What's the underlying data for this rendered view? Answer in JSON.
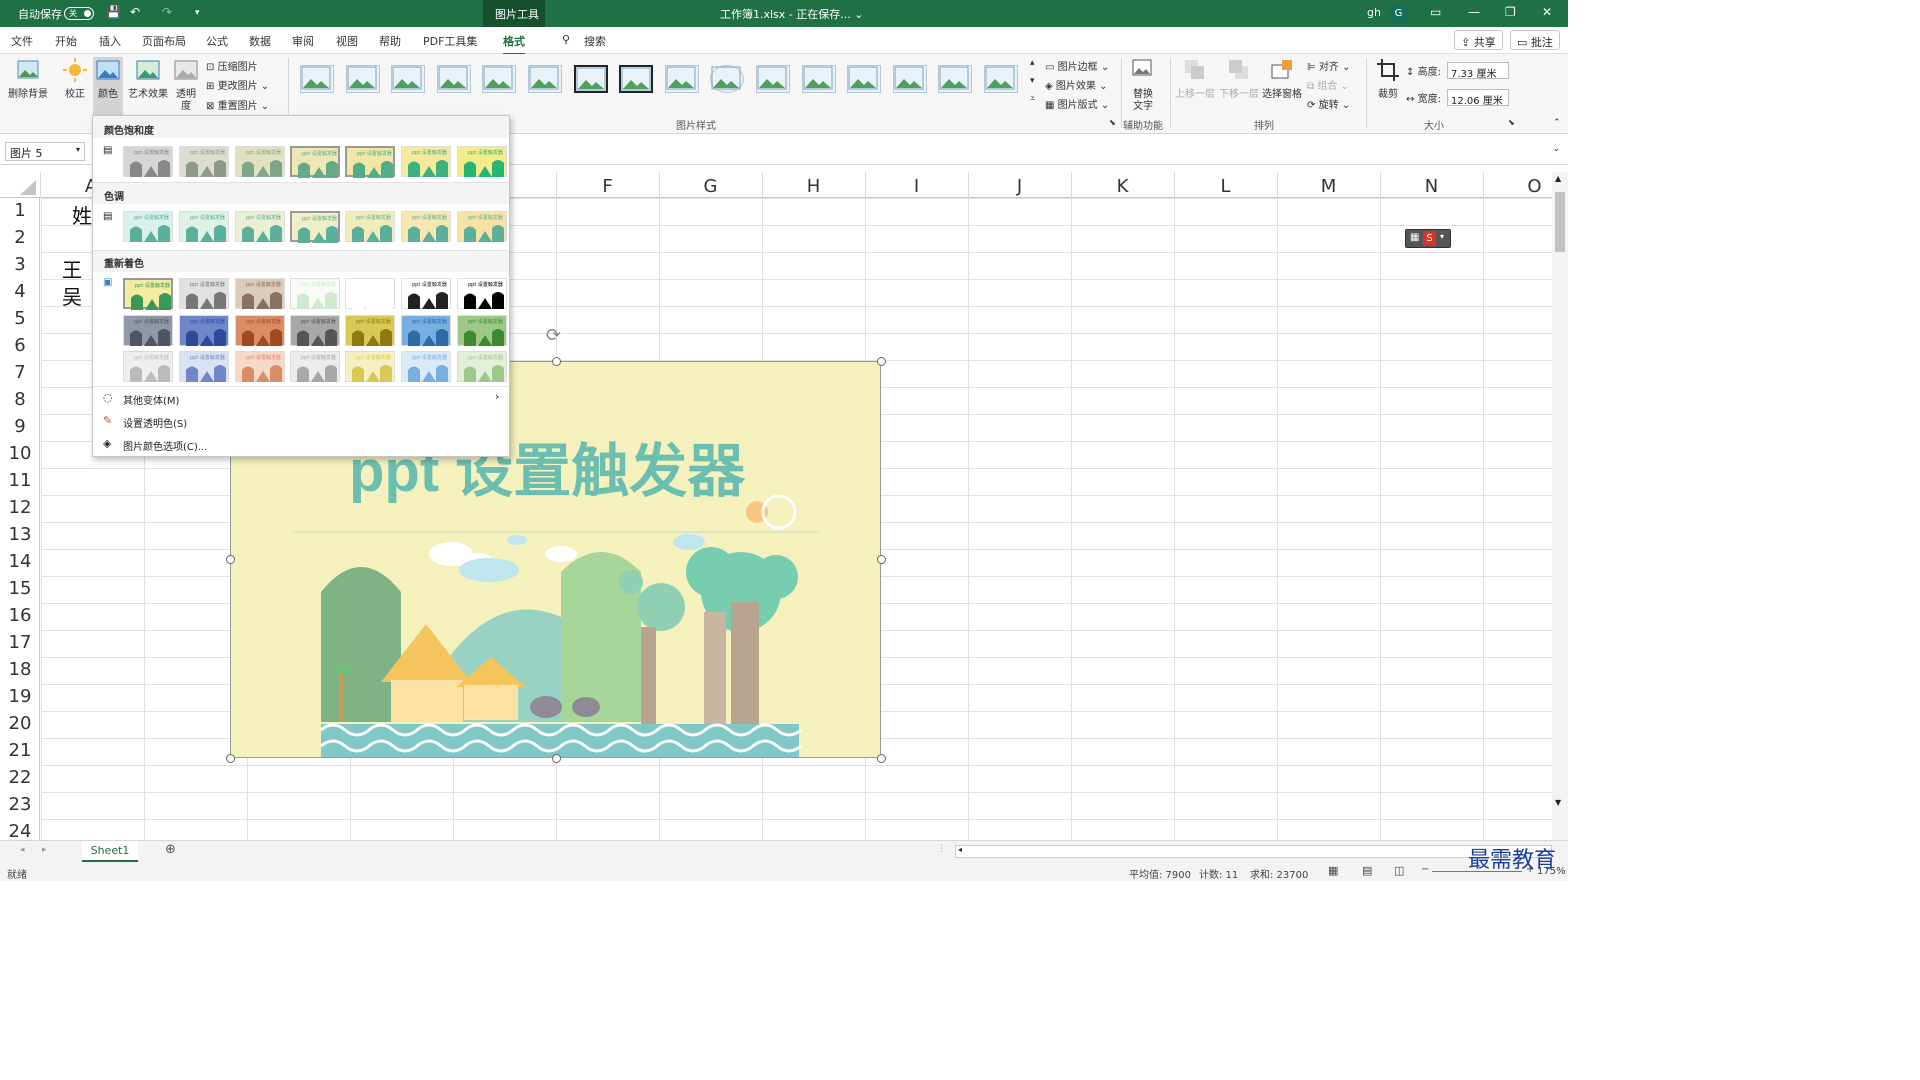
{
  "titlebar": {
    "autosave": "自动保存",
    "autosave_state": "关",
    "tool_tab": "图片工具",
    "filename": "工作簿1.xlsx - 正在保存... ⌄",
    "user": "gh",
    "avatar": "G"
  },
  "tabs": [
    "文件",
    "开始",
    "插入",
    "页面布局",
    "公式",
    "数据",
    "审阅",
    "视图",
    "帮助",
    "PDF工具集",
    "格式"
  ],
  "search": "搜索",
  "share": "共享",
  "comment": "批注",
  "ribbon": {
    "remove_bg": "删除背景",
    "correct": "校正",
    "color": "颜色",
    "art": "艺术效果",
    "transparency_1": "透明",
    "transparency_2": "度",
    "compress": "压缩图片",
    "change": "更改图片",
    "reset": "重置图片",
    "border": "图片边框",
    "effect": "图片效果",
    "layout": "图片版式",
    "styles_group": "图片样式",
    "alt_1": "替换",
    "alt_2": "文字",
    "accessibility": "辅助功能",
    "bring_fwd": "上移一层",
    "send_back": "下移一层",
    "selection_pane": "选择窗格",
    "align": "对齐",
    "group": "组合",
    "rotate": "旋转",
    "arrange": "排列",
    "crop": "裁剪",
    "height_label": "高度:",
    "height_value": "7.33 厘米",
    "width_label": "宽度:",
    "width_value": "12.06 厘米",
    "size": "大小"
  },
  "namebox": "图片 5",
  "columns": [
    "A",
    "F",
    "G",
    "H",
    "I",
    "J",
    "K",
    "L",
    "M",
    "N",
    "O"
  ],
  "rows": [
    "1",
    "2",
    "3",
    "4",
    "5",
    "6",
    "7",
    "8",
    "9",
    "10",
    "11",
    "12",
    "13",
    "14",
    "15",
    "16",
    "17",
    "18",
    "19",
    "20",
    "21",
    "22",
    "23",
    "24"
  ],
  "cells": {
    "a1": "姓",
    "a3": "王",
    "a4": "吴"
  },
  "picture_title": "ppt 设置触发器",
  "thumb_label": "ppt 设置触发器",
  "dropdown": {
    "saturation": "颜色饱和度",
    "tone": "色调",
    "recolor": "重新着色",
    "more_variants": "其他变体(M)",
    "set_transparent": "设置透明色(S)",
    "color_options": "图片颜色选项(C)..."
  },
  "sheet": "Sheet1",
  "status": {
    "ready": "就绪",
    "avg": "平均值: 7900",
    "count": "计数: 11",
    "sum": "求和: 23700",
    "zoom": "175%"
  },
  "watermark": "最需教育",
  "colors": {
    "excel_green": "#1f7145",
    "picture_bg": "#f4f1bd",
    "title_teal": "#6cbfb0"
  }
}
